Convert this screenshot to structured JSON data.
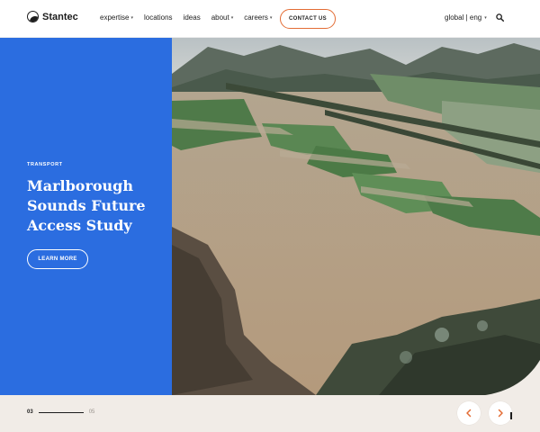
{
  "header": {
    "logo_text": "Stantec",
    "nav": [
      {
        "label": "expertise",
        "has_dropdown": true
      },
      {
        "label": "locations",
        "has_dropdown": false
      },
      {
        "label": "ideas",
        "has_dropdown": false
      },
      {
        "label": "about",
        "has_dropdown": true
      },
      {
        "label": "careers",
        "has_dropdown": true
      }
    ],
    "contact_label": "CONTACT US",
    "lang_label": "global | eng",
    "search_icon": "search-icon"
  },
  "hero": {
    "kicker": "TRANSPORT",
    "headline": "Marlborough Sounds Future Access Study",
    "cta_label": "LEARN MORE",
    "image_subject": "aerial flooded river valley",
    "panel_color": "#2b6de0",
    "accent_color": "#e36c34"
  },
  "carousel": {
    "current": "03",
    "total": "05",
    "prev_icon": "chevron-left-icon",
    "next_icon": "chevron-right-icon"
  }
}
